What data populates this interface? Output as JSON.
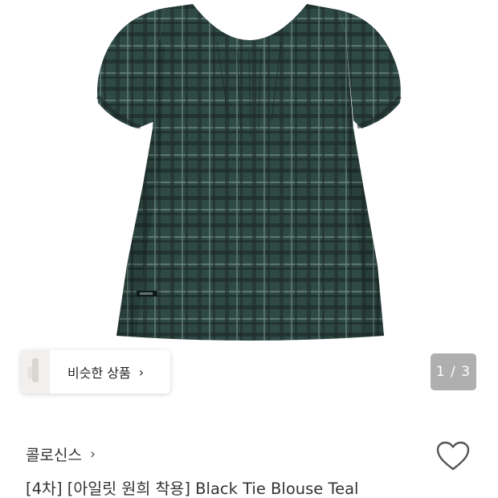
{
  "gallery": {
    "image_icon": "plaid-blouse-product-image",
    "page_current": "1",
    "page_total": "3",
    "page_indicator": "1 / 3"
  },
  "similar": {
    "label": "비슷한 상품",
    "chevron_icon": "chevron-right-icon"
  },
  "product": {
    "brand": "콜로신스",
    "brand_chevron_icon": "chevron-right-icon",
    "title": "[4차] [아일릿 원희 착용] Black Tie Blouse Teal",
    "like_icon": "heart-outline-icon"
  },
  "colors": {
    "fabric_base": "#2f4a45",
    "plaid_dark": "#1e2a2a",
    "plaid_light": "#5b7670",
    "indicator_bg": "#6e6e6e"
  }
}
